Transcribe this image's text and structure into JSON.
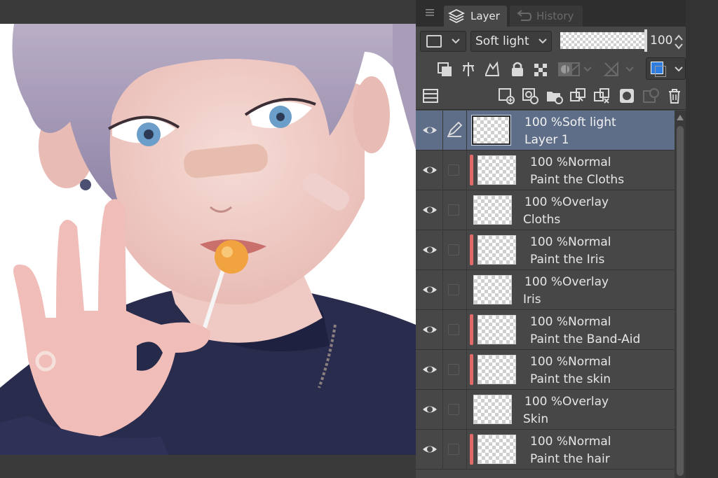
{
  "panel": {
    "tabs": [
      {
        "label": "Layer",
        "icon": "layers-icon",
        "active": true
      },
      {
        "label": "History",
        "icon": "undo-icon",
        "active": false
      }
    ],
    "blend_mode": "Soft light",
    "opacity": "100",
    "opacity_fraction": 1.0
  },
  "layers": [
    {
      "opacity": "100 %",
      "mode": "Soft light",
      "name": "Layer 1",
      "selected": true,
      "color_label": false,
      "editing": true
    },
    {
      "opacity": "100 %",
      "mode": "Normal",
      "name": "Paint the Cloths",
      "selected": false,
      "color_label": true,
      "editing": false
    },
    {
      "opacity": "100 %",
      "mode": "Overlay",
      "name": "Cloths",
      "selected": false,
      "color_label": false,
      "editing": false
    },
    {
      "opacity": "100 %",
      "mode": "Normal",
      "name": "Paint the Iris",
      "selected": false,
      "color_label": true,
      "editing": false
    },
    {
      "opacity": "100 %",
      "mode": "Overlay",
      "name": "Iris",
      "selected": false,
      "color_label": false,
      "editing": false
    },
    {
      "opacity": "100 %",
      "mode": "Normal",
      "name": "Paint the Band-Aid",
      "selected": false,
      "color_label": true,
      "editing": false
    },
    {
      "opacity": "100 %",
      "mode": "Normal",
      "name": "Paint the skin",
      "selected": false,
      "color_label": true,
      "editing": false
    },
    {
      "opacity": "100 %",
      "mode": "Overlay",
      "name": "Skin",
      "selected": false,
      "color_label": false,
      "editing": false
    },
    {
      "opacity": "100 %",
      "mode": "Normal",
      "name": "Paint the hair",
      "selected": false,
      "color_label": true,
      "editing": false
    }
  ],
  "colors": {
    "selected_row": "#5e6d88",
    "color_label": "#e06a6a",
    "panel_bg": "#474747",
    "layer_color_swatch": "#2f7de0"
  }
}
